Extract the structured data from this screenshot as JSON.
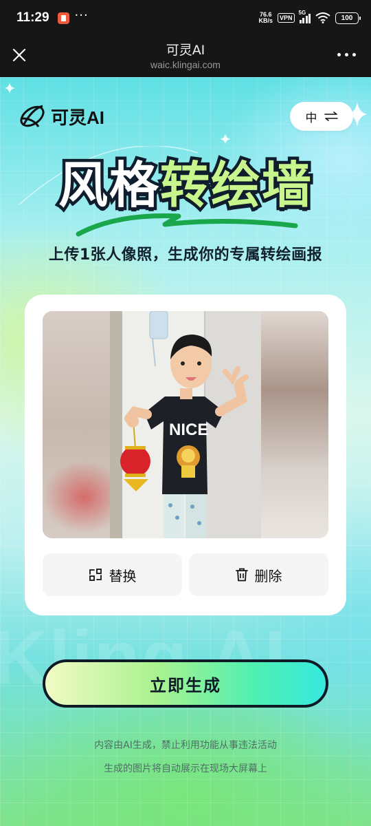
{
  "status_bar": {
    "time": "11:29",
    "more": "···",
    "net_speed_value": "76.6",
    "net_speed_unit": "KB/s",
    "vpn": "VPN",
    "signal_label": "5G",
    "battery": "100",
    "icons": [
      "app-notification-icon",
      "wifi-icon",
      "signal-icon",
      "battery-icon"
    ]
  },
  "browser": {
    "title": "可灵AI",
    "url": "waic.klingai.com",
    "icons": [
      "close-icon",
      "more-icon"
    ]
  },
  "header": {
    "logo_text": "可灵AI",
    "lang_label": "中",
    "lang_icon": "swap-arrows-icon"
  },
  "hero": {
    "title_part1": "风格",
    "title_part2": "转绘墙",
    "subtitle": "上传1张人像照，生成你的专属转绘画报"
  },
  "card": {
    "replace_label": "替换",
    "delete_label": "删除",
    "replace_icon": "replace-icon",
    "delete_icon": "trash-icon"
  },
  "generate_button": "立即生成",
  "watermark": "Kling AI",
  "footnotes": [
    "内容由AI生成，禁止利用功能从事违法活动",
    "生成的图片将自动展示在现场大屏幕上"
  ],
  "colors": {
    "title_dark": "#0f1d2c",
    "title_green": "#c8f58c",
    "button_gradient_start": "#f1fbc4",
    "button_gradient_end": "#36e9de",
    "card_button_bg": "#f5f5f5"
  }
}
